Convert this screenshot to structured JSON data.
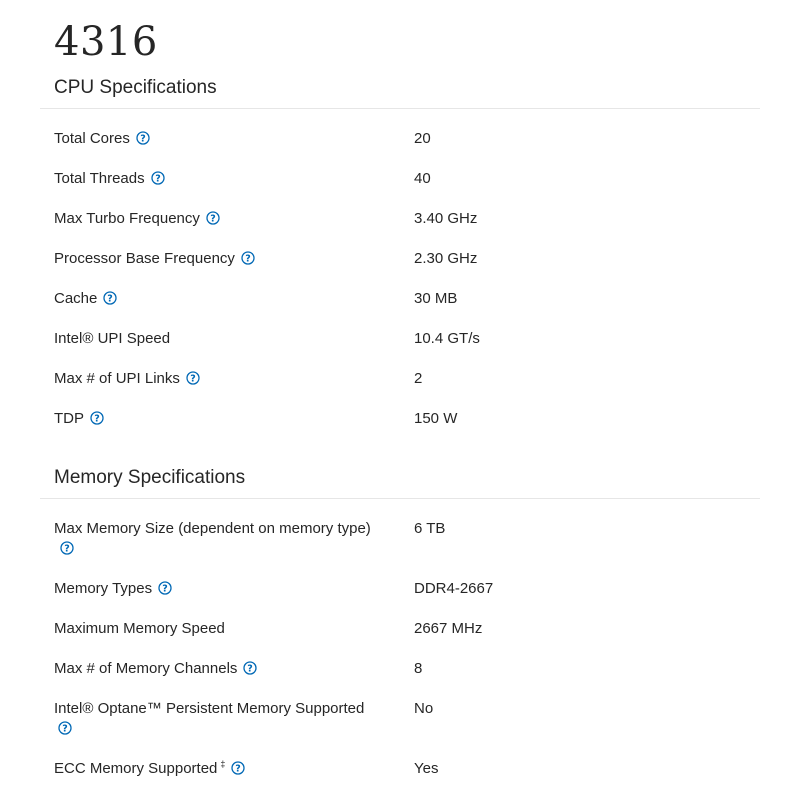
{
  "page": {
    "title": "4316"
  },
  "cpu_specs": {
    "title": "CPU Specifications",
    "rows": [
      {
        "label": "Total Cores",
        "value": "20",
        "help": true
      },
      {
        "label": "Total Threads",
        "value": "40",
        "help": true
      },
      {
        "label": "Max Turbo Frequency",
        "value": "3.40 GHz",
        "help": true
      },
      {
        "label": "Processor Base Frequency",
        "value": "2.30 GHz",
        "help": true
      },
      {
        "label": "Cache",
        "value": "30 MB",
        "help": true
      },
      {
        "label": "Intel® UPI Speed",
        "value": "10.4 GT/s",
        "help": false
      },
      {
        "label": "Max # of UPI Links",
        "value": "2",
        "help": true
      },
      {
        "label": "TDP",
        "value": "150 W",
        "help": true
      }
    ]
  },
  "memory_specs": {
    "title": "Memory Specifications",
    "rows": [
      {
        "label": "Max Memory Size (dependent on memory type)",
        "value": "6 TB",
        "help": true
      },
      {
        "label": "Memory Types",
        "value": "DDR4-2667",
        "help": true
      },
      {
        "label": "Maximum Memory Speed",
        "value": "2667 MHz",
        "help": false
      },
      {
        "label": "Max # of Memory Channels",
        "value": "8",
        "help": true
      },
      {
        "label": "Intel® Optane™ Persistent Memory Supported",
        "value": "No",
        "help": true
      },
      {
        "label": "ECC Memory Supported",
        "value": "Yes",
        "help": true,
        "footnote_mark": "‡"
      }
    ]
  },
  "icons": {
    "help": "question-circle-icon",
    "accent_color": "#0068b5"
  }
}
